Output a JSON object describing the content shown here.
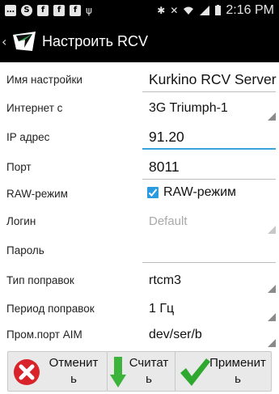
{
  "status_bar": {
    "time": "2:16 PM",
    "left_icons": [
      "message-icon",
      "skype-icon",
      "facebook-icon",
      "facebook-icon",
      "facebook-icon",
      "usb-icon"
    ],
    "right_icons": [
      "bluetooth-icon",
      "mute-icon",
      "wifi-icon",
      "signal-icon",
      "battery-icon"
    ]
  },
  "action_bar": {
    "title": "Настроить RCV",
    "back_glyph": "‹"
  },
  "form": {
    "rows": [
      {
        "label": "Имя настройки",
        "value": "Kurkino RCV Server",
        "type": "text"
      },
      {
        "label": "Интернет с",
        "value": "3G Triumph-1",
        "type": "spinner"
      },
      {
        "label": "IP адрес",
        "value": "91.20",
        "type": "text-focused"
      },
      {
        "label": "Порт",
        "value": "8011",
        "type": "text"
      },
      {
        "label": "RAW-режим",
        "value": "RAW-режим",
        "type": "checkbox",
        "checked": true
      },
      {
        "label": "Логин",
        "value": "Default",
        "type": "spinner-disabled"
      },
      {
        "label": "Пароль",
        "value": "",
        "type": "text"
      },
      {
        "label": "Тип поправок",
        "value": "rtcm3",
        "type": "spinner"
      },
      {
        "label": "Период поправок",
        "value": "1 Гц",
        "type": "spinner"
      },
      {
        "label": "Пром.порт AIM",
        "value": "dev/ser/b",
        "type": "spinner"
      }
    ]
  },
  "buttons": {
    "cancel": {
      "line1": "Отменит",
      "line2": "ь"
    },
    "read": {
      "line1": "Считат",
      "line2": "ь"
    },
    "apply": {
      "line1": "Применит",
      "line2": "ь"
    }
  },
  "colors": {
    "focus_underline": "#3aa2dc",
    "checkbox": "#2a9be0",
    "cancel_red": "#d9232a",
    "read_green": "#3cb43c",
    "apply_green": "#2fa82f"
  }
}
